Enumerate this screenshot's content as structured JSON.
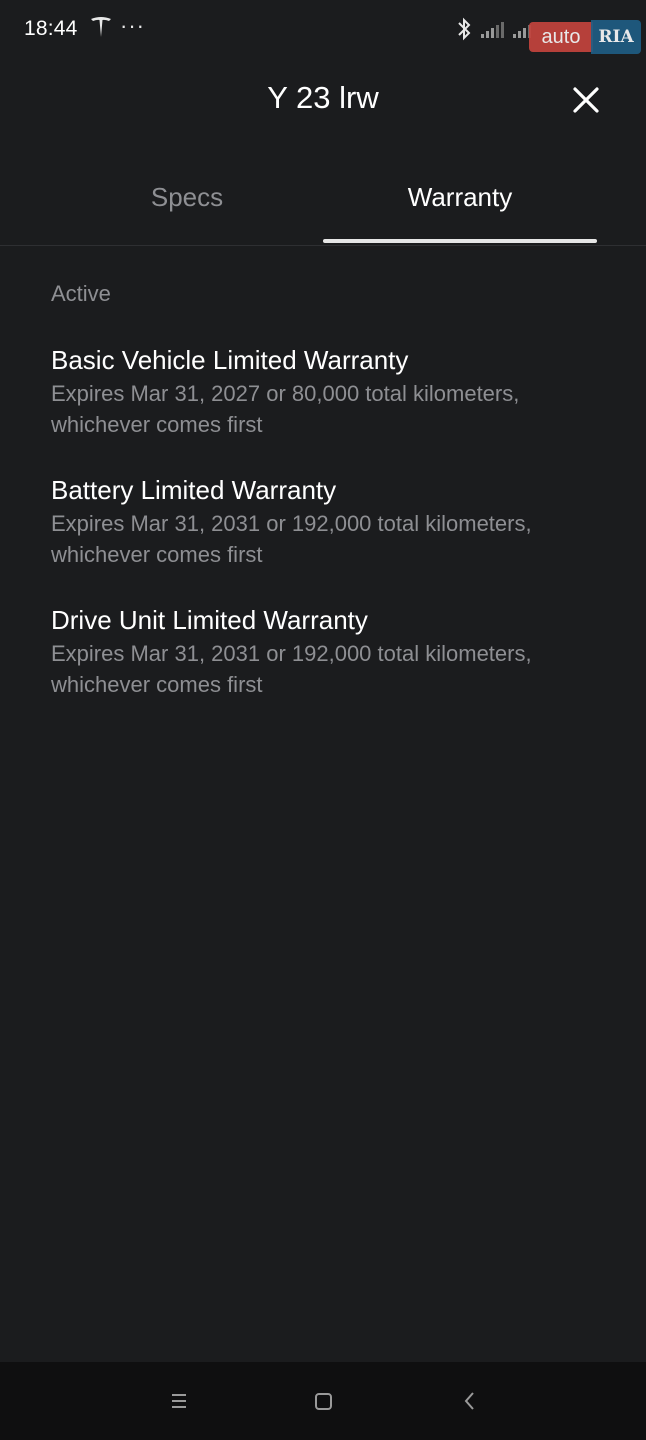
{
  "status_bar": {
    "time": "18:44",
    "more": "···",
    "icons": [
      "tesla-logo-icon",
      "bluetooth-icon",
      "signal-icon",
      "signal-icon"
    ]
  },
  "watermark": {
    "auto": "auto",
    "ria": "RIA"
  },
  "header": {
    "title": "Y 23 lrw",
    "close_icon": "close-icon"
  },
  "tabs": [
    {
      "label": "Specs",
      "active": false
    },
    {
      "label": "Warranty",
      "active": true
    }
  ],
  "warranty": {
    "section_label": "Active",
    "items": [
      {
        "title": "Basic Vehicle Limited Warranty",
        "line1": "Expires Mar 31, 2027 or 80,000 total kilometers,",
        "line2": "whichever comes first"
      },
      {
        "title": "Battery Limited Warranty",
        "line1": "Expires Mar 31, 2031 or 192,000 total kilometers,",
        "line2": "whichever comes first"
      },
      {
        "title": "Drive Unit Limited Warranty",
        "line1": "Expires Mar 31, 2031 or 192,000 total kilometers,",
        "line2": "whichever comes first"
      }
    ]
  },
  "nav_bar": {
    "icons": [
      "menu-icon",
      "home-square-icon",
      "back-chevron-icon"
    ]
  },
  "colors": {
    "background": "#1b1c1e",
    "primary_text": "#ffffff",
    "secondary_text": "#8e8f93",
    "tab_indicator": "#e6e6e6"
  }
}
